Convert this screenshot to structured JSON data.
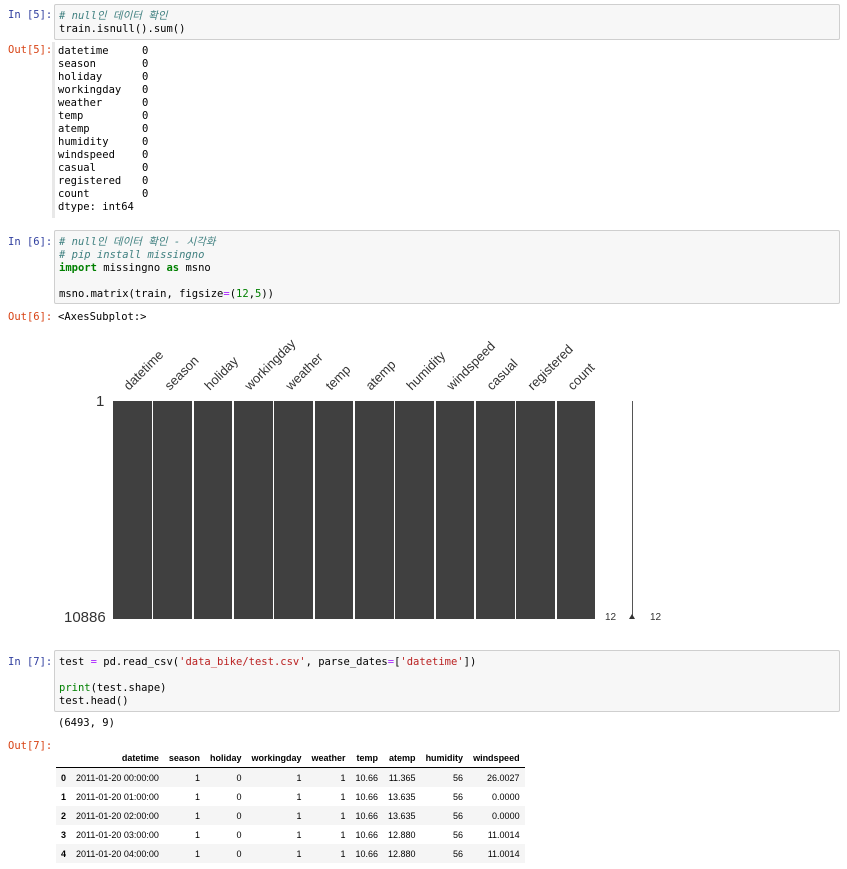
{
  "cells": {
    "c5": {
      "in_prompt": "In [5]:",
      "out_prompt": "Out[5]:",
      "comment": "# null인 데이터 확인",
      "code": "train.isnull().sum()",
      "output_rows": [
        {
          "name": "datetime",
          "value": "0"
        },
        {
          "name": "season",
          "value": "0"
        },
        {
          "name": "holiday",
          "value": "0"
        },
        {
          "name": "workingday",
          "value": "0"
        },
        {
          "name": "weather",
          "value": "0"
        },
        {
          "name": "temp",
          "value": "0"
        },
        {
          "name": "atemp",
          "value": "0"
        },
        {
          "name": "humidity",
          "value": "0"
        },
        {
          "name": "windspeed",
          "value": "0"
        },
        {
          "name": "casual",
          "value": "0"
        },
        {
          "name": "registered",
          "value": "0"
        },
        {
          "name": "count",
          "value": "0"
        }
      ],
      "dtype": "dtype: int64"
    },
    "c6": {
      "in_prompt": "In [6]:",
      "out_prompt": "Out[6]:",
      "comment1": "# null인 데이터 확인 - 시각화",
      "comment2": "# pip install missingno",
      "kw_import": "import",
      "mod": " missingno ",
      "kw_as": "as",
      "alias": " msno",
      "call_pre": "msno.matrix(train, figsize",
      "call_eq": "=",
      "call_args_open": "(",
      "n12": "12",
      "comma": ",",
      "n5": "5",
      "call_close": "))",
      "output_text": "<AxesSubplot:>",
      "matrix": {
        "columns": [
          "datetime",
          "season",
          "holiday",
          "workingday",
          "weather",
          "temp",
          "atemp",
          "humidity",
          "windspeed",
          "casual",
          "registered",
          "count"
        ],
        "row_top": "1",
        "row_bottom": "10886",
        "spark_left": "12",
        "spark_right": "12",
        "fill_color": "#404040"
      }
    },
    "c7": {
      "in_prompt": "In [7]:",
      "out_prompt": "Out[7]:",
      "line1_a": "test ",
      "line1_eq": "=",
      "line1_b": " pd.read_csv(",
      "line1_str1": "'data_bike/test.csv'",
      "line1_c": ", parse_dates",
      "line1_eq2": "=",
      "line1_d": "[",
      "line1_str2": "'datetime'",
      "line1_e": "])",
      "line2_print": "print",
      "line2_rest": "(test.shape)",
      "line3": "test.head()",
      "shape_out": "(6493, 9)",
      "table": {
        "headers": [
          "",
          "datetime",
          "season",
          "holiday",
          "workingday",
          "weather",
          "temp",
          "atemp",
          "humidity",
          "windspeed"
        ],
        "rows": [
          [
            "0",
            "2011-01-20 00:00:00",
            "1",
            "0",
            "1",
            "1",
            "10.66",
            "11.365",
            "56",
            "26.0027"
          ],
          [
            "1",
            "2011-01-20 01:00:00",
            "1",
            "0",
            "1",
            "1",
            "10.66",
            "13.635",
            "56",
            "0.0000"
          ],
          [
            "2",
            "2011-01-20 02:00:00",
            "1",
            "0",
            "1",
            "1",
            "10.66",
            "13.635",
            "56",
            "0.0000"
          ],
          [
            "3",
            "2011-01-20 03:00:00",
            "1",
            "0",
            "1",
            "1",
            "10.66",
            "12.880",
            "56",
            "11.0014"
          ],
          [
            "4",
            "2011-01-20 04:00:00",
            "1",
            "0",
            "1",
            "1",
            "10.66",
            "12.880",
            "56",
            "11.0014"
          ]
        ]
      }
    }
  }
}
